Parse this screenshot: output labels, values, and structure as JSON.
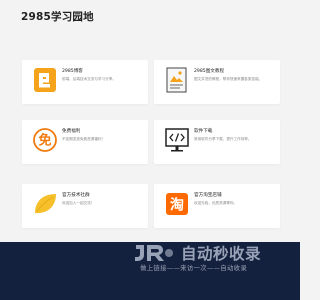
{
  "site": {
    "title": "2985学习园地"
  },
  "cards": [
    {
      "title": "2985博客",
      "desc": "前端、后端技术交流与学习分享。",
      "icon": "blog-b-icon"
    },
    {
      "title": "2985图文教程",
      "desc": "图文并茂的教程，帮你快速掌握各类技能。",
      "icon": "tutorial-document-icon"
    },
    {
      "title": "免费福利",
      "desc": "不定期发放免费资源福利！",
      "icon": "free-badge-icon"
    },
    {
      "title": "软件下载",
      "desc": "常用软件分享下载，提升工作效率。",
      "icon": "code-monitor-icon"
    },
    {
      "title": "官方技术社群",
      "desc": "欢迎加入一起交流！",
      "icon": "leaf-icon"
    },
    {
      "title": "官方淘宝店铺",
      "desc": "欢迎光临，优质资源等你。",
      "icon": "taobao-icon"
    }
  ],
  "watermark": {
    "logo_text": "JR",
    "big_text": "自动秒收录",
    "small_text": "做上链接——来访一次——自动收录"
  },
  "colors": {
    "orange": "#f5a31a",
    "taobao": "#ff6a00",
    "leaf": "#f6c02b",
    "footer": "#14213e"
  }
}
